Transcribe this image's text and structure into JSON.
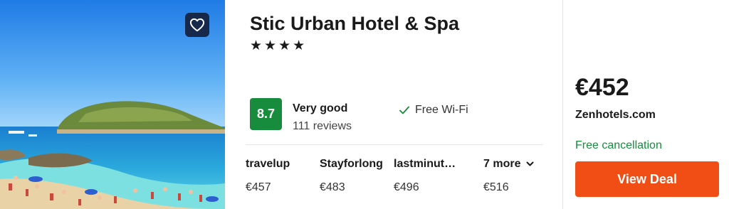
{
  "hotel": {
    "name": "Stic Urban Hotel & Spa",
    "stars": [
      "★",
      "★",
      "★",
      "★"
    ],
    "image_icon": "beach-photo",
    "favorite_icon": "heart-icon"
  },
  "rating": {
    "score": "8.7",
    "label": "Very good",
    "reviews": "111 reviews",
    "badge_color": "#168c3c"
  },
  "amenities": [
    {
      "label": "Free Wi-Fi",
      "icon": "check-icon"
    }
  ],
  "providers": [
    {
      "name": "travelup",
      "price": "€457"
    },
    {
      "name": "Stayforlong",
      "price": "€483"
    },
    {
      "name": "lastminut…",
      "price": "€496"
    }
  ],
  "more": {
    "label": "7 more",
    "price": "€516",
    "icon": "chevron-down-icon"
  },
  "deal": {
    "price": "€452",
    "site": "Zenhotels.com",
    "cancellation": "Free cancellation",
    "button_label": "View Deal",
    "button_color": "#f04e14",
    "cancellation_color": "#168c3c"
  }
}
